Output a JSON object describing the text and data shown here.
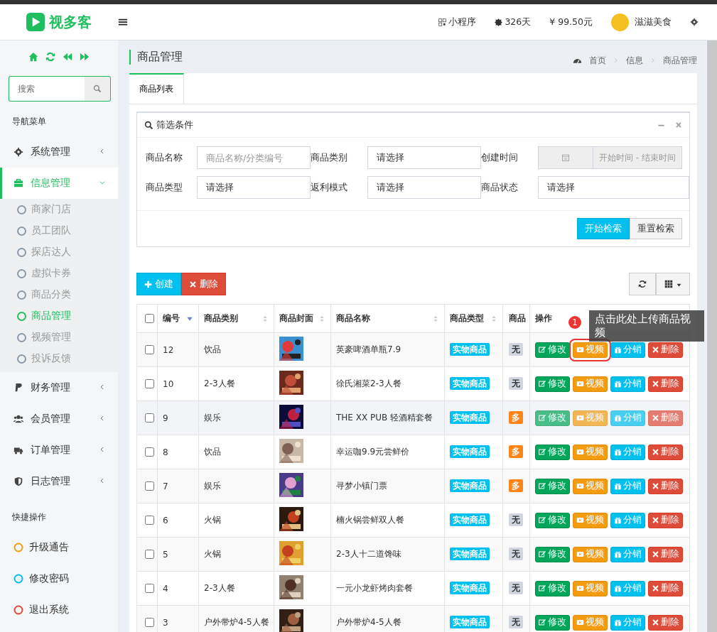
{
  "header": {
    "logo_text": "视多客",
    "items": [
      {
        "kind": "qr",
        "text": "小程序"
      },
      {
        "kind": "days",
        "text": "326天"
      },
      {
        "kind": "money",
        "text": "¥ 99.50元"
      }
    ],
    "user": "滋滋美食"
  },
  "sidebar": {
    "search_placeholder": "搜索",
    "nav_title": "导航菜单",
    "menu": [
      {
        "label": "系统管理",
        "expanded": false
      },
      {
        "label": "信息管理",
        "expanded": true,
        "children": [
          {
            "label": "商家门店",
            "selected": false
          },
          {
            "label": "员工团队",
            "selected": false
          },
          {
            "label": "探店达人",
            "selected": false
          },
          {
            "label": "虚拟卡券",
            "selected": false
          },
          {
            "label": "商品分类",
            "selected": false
          },
          {
            "label": "商品管理",
            "selected": true
          },
          {
            "label": "视频管理",
            "selected": false
          },
          {
            "label": "投诉反馈",
            "selected": false
          }
        ]
      },
      {
        "label": "财务管理",
        "expanded": false
      },
      {
        "label": "会员管理",
        "expanded": false
      },
      {
        "label": "订单管理",
        "expanded": false
      },
      {
        "label": "日志管理",
        "expanded": false
      }
    ],
    "quick_title": "快捷操作",
    "quick": [
      {
        "label": "升级通告",
        "color": "#f39c12"
      },
      {
        "label": "修改密码",
        "color": "#00c0ef"
      },
      {
        "label": "退出系统",
        "color": "#dd4b39"
      }
    ]
  },
  "page": {
    "title": "商品管理",
    "breadcrumb": [
      "首页",
      "信息",
      "商品管理"
    ]
  },
  "tabs": [
    {
      "label": "商品列表",
      "selected": true
    }
  ],
  "filter": {
    "title": "筛选条件",
    "fields": [
      {
        "label": "商品名称",
        "kind": "text",
        "placeholder": "商品名称/分类编号"
      },
      {
        "label": "商品类别",
        "kind": "select",
        "value": "请选择"
      },
      {
        "label": "创建时间",
        "kind": "date",
        "placeholder": "开始时间 - 结束时间"
      },
      {
        "label": "商品类型",
        "kind": "select",
        "value": "请选择"
      },
      {
        "label": "返利模式",
        "kind": "select",
        "value": "请选择"
      },
      {
        "label": "商品状态",
        "kind": "select",
        "value": "请选择"
      }
    ],
    "search_button": "开始检索",
    "reset_button": "重置检索"
  },
  "toolbar": {
    "create": "创建",
    "delete": "删除"
  },
  "table": {
    "select_all_checked": false,
    "columns": [
      {
        "label": "编号",
        "sorted": true
      },
      {
        "label": "商品类别",
        "sorted": false
      },
      {
        "label": "商品封面",
        "sorted": false
      },
      {
        "label": "商品名称",
        "sorted": false
      },
      {
        "label": "商品类型",
        "sorted": false
      },
      {
        "label": "商品"
      },
      {
        "label": "操作"
      }
    ],
    "rows": [
      {
        "id": "12",
        "category": "饮品",
        "name": "英豪啤酒单瓶7.9",
        "checked": false,
        "type": "实物商品",
        "mode": {
          "text": "无",
          "kind": "none"
        },
        "hovered": false,
        "actions": [
          "修改",
          "视频",
          "分销",
          "删除"
        ]
      },
      {
        "id": "10",
        "category": "2-3人餐",
        "name": "徐氏湘菜2-3人餐",
        "checked": false,
        "type": "实物商品",
        "mode": {
          "text": "无",
          "kind": "none"
        },
        "hovered": false,
        "actions": [
          "修改",
          "视频",
          "分销",
          "删除"
        ]
      },
      {
        "id": "9",
        "category": "娱乐",
        "name": "THE XX PUB 轻酒精套餐",
        "checked": false,
        "type": "实物商品",
        "mode": {
          "text": "多",
          "kind": "multi"
        },
        "hovered": true,
        "actions": [
          "修改",
          "视频",
          "分销",
          "删除"
        ]
      },
      {
        "id": "8",
        "category": "饮品",
        "name": "幸运咖9.9元尝鲜价",
        "checked": false,
        "type": "实物商品",
        "mode": {
          "text": "多",
          "kind": "multi"
        },
        "hovered": false,
        "actions": [
          "修改",
          "视频",
          "分销",
          "删除"
        ]
      },
      {
        "id": "7",
        "category": "娱乐",
        "name": "寻梦小镇门票",
        "checked": false,
        "type": "实物商品",
        "mode": {
          "text": "多",
          "kind": "multi"
        },
        "hovered": false,
        "actions": [
          "修改",
          "视频",
          "分销",
          "删除"
        ]
      },
      {
        "id": "6",
        "category": "火锅",
        "name": "楠火锅尝鲜双人餐",
        "checked": false,
        "type": "实物商品",
        "mode": {
          "text": "无",
          "kind": "none"
        },
        "hovered": false,
        "actions": [
          "修改",
          "视频",
          "分销",
          "删除"
        ]
      },
      {
        "id": "5",
        "category": "火锅",
        "name": "2-3人十二道馋味",
        "checked": false,
        "type": "实物商品",
        "mode": {
          "text": "无",
          "kind": "none"
        },
        "hovered": false,
        "actions": [
          "修改",
          "视频",
          "分销",
          "删除"
        ]
      },
      {
        "id": "4",
        "category": "2-3人餐",
        "name": "一元小龙虾烤肉套餐",
        "checked": false,
        "type": "实物商品",
        "mode": {
          "text": "无",
          "kind": "none"
        },
        "hovered": false,
        "actions": [
          "修改",
          "视频",
          "分销",
          "删除"
        ]
      },
      {
        "id": "3",
        "category": "户外带炉4-5人餐",
        "name": "户外带炉4-5人餐",
        "checked": false,
        "type": "实物商品",
        "mode": {
          "text": "无",
          "kind": "none"
        },
        "hovered": false,
        "actions": [
          "修改",
          "视频",
          "分销",
          "删除"
        ]
      }
    ]
  },
  "tooltip": {
    "badge": "1",
    "text": "点击此处上传商品视频"
  }
}
